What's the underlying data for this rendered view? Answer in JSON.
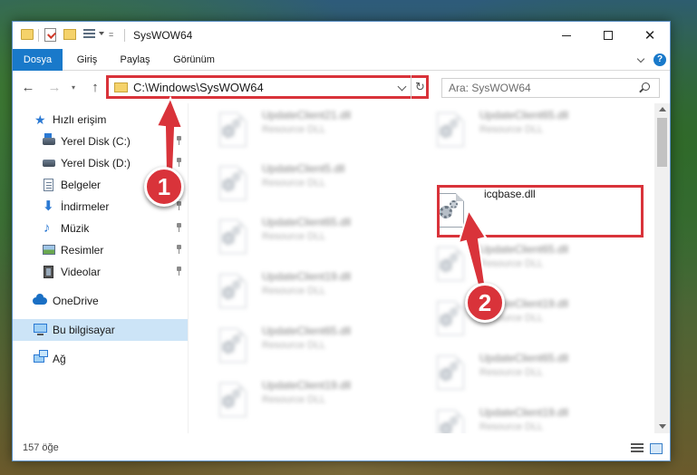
{
  "window": {
    "title": "SysWOW64",
    "quick_access_custom": "="
  },
  "ribbon": {
    "tabs": [
      "Dosya",
      "Giriş",
      "Paylaş",
      "Görünüm"
    ],
    "help": "?"
  },
  "navigation": {
    "back": "←",
    "forward": "→",
    "recent": "▾",
    "up": "↑",
    "address": "C:\\Windows\\SysWOW64",
    "refresh": "↻",
    "search_placeholder": "Ara: SysWOW64"
  },
  "sidebar": {
    "quick_access": "Hızlı erişim",
    "items": [
      {
        "label": "Yerel Disk (C:)",
        "icon": "disk-c-icon",
        "pinned": true
      },
      {
        "label": "Yerel Disk (D:)",
        "icon": "disk-d-icon",
        "pinned": true
      },
      {
        "label": "Belgeler",
        "icon": "documents-icon",
        "pinned": true
      },
      {
        "label": "İndirmeler",
        "icon": "downloads-icon",
        "pinned": true
      },
      {
        "label": "Müzik",
        "icon": "music-icon",
        "pinned": true
      },
      {
        "label": "Resimler",
        "icon": "pictures-icon",
        "pinned": true
      },
      {
        "label": "Videolar",
        "icon": "videos-icon",
        "pinned": true
      }
    ],
    "onedrive": "OneDrive",
    "this_pc": "Bu bilgisayar",
    "network": "Ağ"
  },
  "files": {
    "left_column": [
      {
        "name": "UpdateClient21.dll",
        "type": "Resource DLL"
      },
      {
        "name": "UpdateClient5.dll",
        "type": "Resource DLL"
      },
      {
        "name": "UpdateClient65.dll",
        "type": "Resource DLL"
      },
      {
        "name": "UpdateClient19.dll",
        "type": "Resource DLL"
      },
      {
        "name": "UpdateClient65.dll",
        "type": "Resource DLL"
      },
      {
        "name": "UpdateClient19.dll",
        "type": "Resource DLL"
      }
    ],
    "right_column": [
      {
        "name": "UpdateClient65.dll",
        "type": "Resource DLL"
      },
      {
        "name": "icqbase.dll",
        "type": "",
        "highlighted": true
      },
      {
        "name": "UpdateClient65.dll",
        "type": "Resource DLL"
      },
      {
        "name": "UpdateClient19.dll",
        "type": "Resource DLL"
      },
      {
        "name": "UpdateClient65.dll",
        "type": "Resource DLL"
      },
      {
        "name": "UpdateClient19.dll",
        "type": "Resource DLL"
      }
    ]
  },
  "status": {
    "item_count": "157 öğe"
  },
  "annotations": {
    "step1": "1",
    "step2": "2",
    "color": "#d9333a"
  }
}
